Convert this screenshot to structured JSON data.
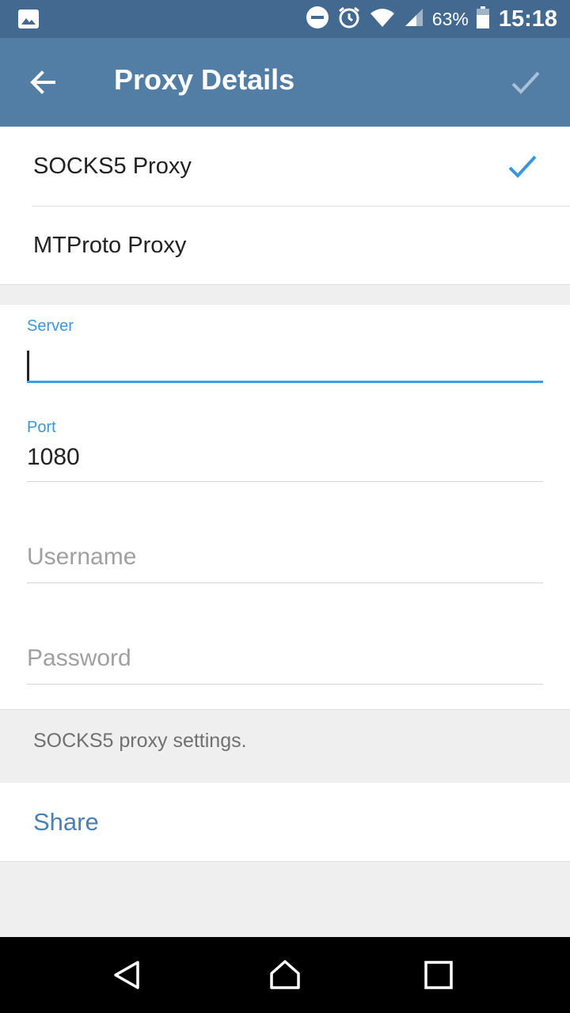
{
  "status_bar": {
    "battery": "63%",
    "time": "15:18",
    "icons": [
      "image-icon",
      "dnd-icon",
      "alarm-icon",
      "wifi-icon",
      "signal-icon",
      "battery-icon"
    ]
  },
  "app_bar": {
    "title": "Proxy Details",
    "back_icon": "arrow-left-icon",
    "done_icon": "check-icon"
  },
  "proxy_types": [
    {
      "label": "SOCKS5 Proxy",
      "selected": true
    },
    {
      "label": "MTProto Proxy",
      "selected": false
    }
  ],
  "fields": {
    "server": {
      "label": "Server",
      "value": ""
    },
    "port": {
      "label": "Port",
      "value": "1080"
    },
    "username": {
      "placeholder": "Username",
      "value": ""
    },
    "password": {
      "placeholder": "Password",
      "value": ""
    }
  },
  "info_text": "SOCKS5 proxy settings.",
  "share_label": "Share",
  "colors": {
    "status_bar": "#42698f",
    "app_bar": "#527ea6",
    "accent": "#3a9fe3",
    "share_link": "#4a81b5"
  },
  "nav_bar": {
    "icons": [
      "back-triangle-icon",
      "home-icon",
      "recents-icon"
    ]
  }
}
